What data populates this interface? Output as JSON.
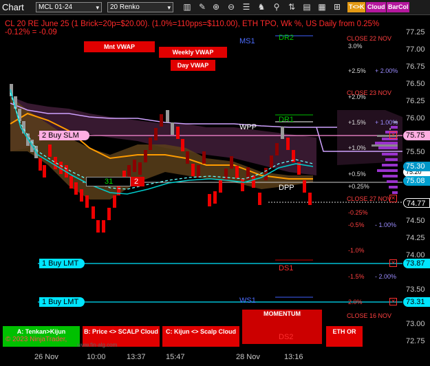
{
  "toolbar": {
    "title": "Chart",
    "instrument": "MCL 01-24",
    "bar_type": "20 Renko",
    "tk_label": "T<>K",
    "cloud_label": "Cloud",
    "barcol_label": "BarCol"
  },
  "header": {
    "line1": "CL 20 RE June 25 (1 Brick=20p=$20.00). (1.0%=110pps=$110.00), ETH TPO, Wk %, US Daily from 0.25%",
    "line2": " -0.12% = -0.09"
  },
  "vwap": {
    "month": "Mnt VWAP",
    "week": "Weekly VWAP",
    "day": "Day VWAP"
  },
  "levels": {
    "ms1": "MS1",
    "dr2": "DR2",
    "dr1": "DR1",
    "wpp": "WPP",
    "dpp": "DPP",
    "ds1": "DS1",
    "ws1": "WS1",
    "ds2": "DS2",
    "close_22": "CLOSE 22 NOV",
    "close_23": "CLOSE 23 NOV",
    "close_27": "CLOSE 27 NOV",
    "close_16": "CLOSE 16 NOV"
  },
  "pct_left": {
    "p30": "3.0%",
    "p25": "+2.5%",
    "p20": "+2.0%",
    "p15": "+1.5%",
    "p10": "+1.0%",
    "p05": "+0.5%",
    "p025": "+0.25%",
    "m025": "-0.25%",
    "m05": "-0.5%",
    "m10": "-1.0%",
    "m15": "-1.5%",
    "m20": "2.0%"
  },
  "pct_right": {
    "p20": "+ 2.00%",
    "p10": "+ 1.00%",
    "m10": "- 1.00%",
    "m20": "- 2.00%"
  },
  "orders": {
    "buy_slm": "2 Buy SLM",
    "buy_lmt_1": "1 Buy LMT",
    "buy_lmt_2": "1 Buy LMT",
    "position_qty": "31",
    "position_count": "2"
  },
  "price_axis": [
    "77.25",
    "77.00",
    "76.75",
    "76.50",
    "76.25",
    "76.00",
    "75.75",
    "75.50",
    "75.25",
    "75.00",
    "74.75",
    "74.50",
    "74.25",
    "74.00",
    "73.75",
    "73.50",
    "73.25",
    "73.00",
    "72.75"
  ],
  "price_boxes": {
    "slm": "75.75",
    "p1": "75.30",
    "current": "75.08",
    "last": "74.77",
    "lmt1": "73.87",
    "lmt2": "73.31",
    "hidden": "75.20"
  },
  "time_axis": [
    "26 Nov",
    "10:00",
    "13:37",
    "15:47",
    "28 Nov",
    "13:16"
  ],
  "buttons": {
    "tenkan": "A: Tenkan>Kijun",
    "scalp": "B: Price <> SCALP Cloud",
    "kijun": "C: Kijun <> Scalp Cloud",
    "momentum": "MOMENTUM",
    "eth": "ETH OR"
  },
  "watermark": "© 2023 NinjaTrader,",
  "watermark2": "www.fin-alg.com",
  "colors": {
    "accent_red": "#e00000",
    "cyan": "#00e5ff",
    "pink": "#ff8cd8",
    "green": "#00c000"
  }
}
